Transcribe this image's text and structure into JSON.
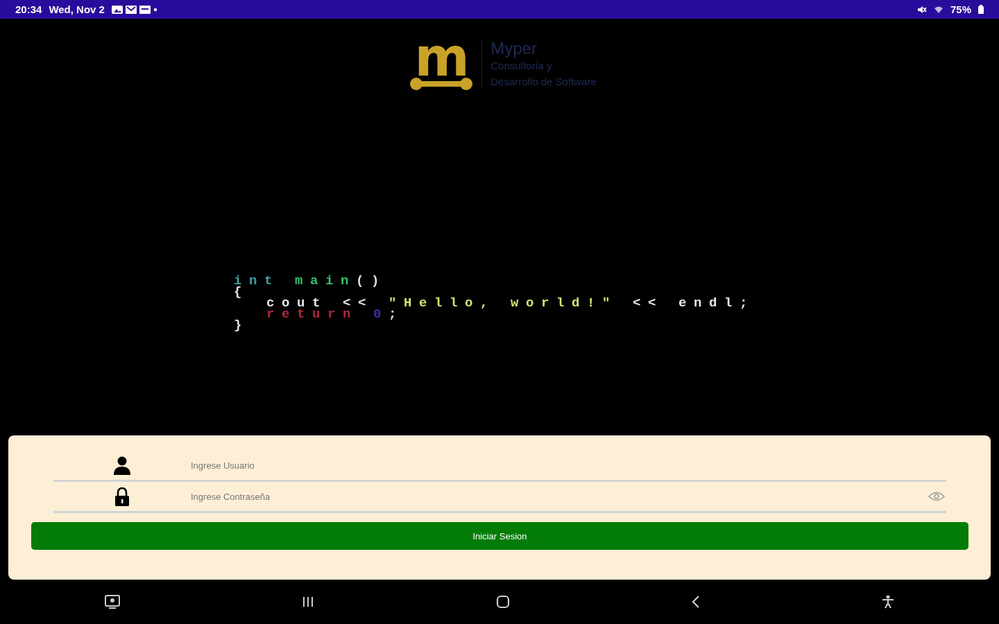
{
  "status_bar": {
    "time": "20:34",
    "date": "Wed, Nov 2",
    "battery": "75%"
  },
  "logo": {
    "mark": "m",
    "name": "Myper",
    "tagline_1": "Consultoría y",
    "tagline_2": "Desarrollo de Software"
  },
  "code_lines": [
    {
      "indent": false,
      "tokens": [
        {
          "text": "int",
          "color": "#3fa0a0"
        },
        {
          "text": " main",
          "color": "#3cbf6a"
        },
        {
          "text": "()",
          "color": "#e0e0e0"
        }
      ]
    },
    {
      "indent": false,
      "tokens": [
        {
          "text": "{",
          "color": "#e0e0e0"
        }
      ]
    },
    {
      "indent": true,
      "tokens": [
        {
          "text": "cout << ",
          "color": "#e8e8e8"
        },
        {
          "text": "\"Hello, world!\"",
          "color": "#d8e070"
        },
        {
          "text": " << endl;",
          "color": "#e8e8e8"
        }
      ]
    },
    {
      "indent": true,
      "tokens": [
        {
          "text": "return",
          "color": "#b0283a"
        },
        {
          "text": " 0",
          "color": "#4a2aa8"
        },
        {
          "text": ";",
          "color": "#e0e0e0"
        }
      ]
    },
    {
      "indent": false,
      "tokens": [
        {
          "text": "}",
          "color": "#e0e0e0"
        }
      ]
    }
  ],
  "login": {
    "username": {
      "placeholder": "Ingrese Usuario"
    },
    "password": {
      "placeholder": "Ingrese Contraseña"
    },
    "submit": "Iniciar Sesion"
  }
}
